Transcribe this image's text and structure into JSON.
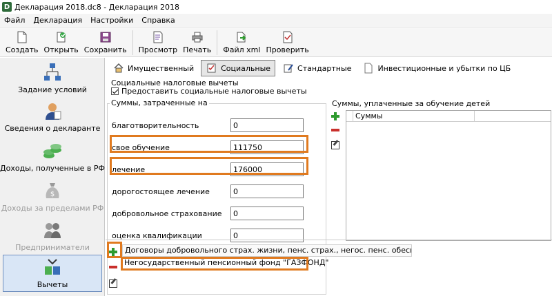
{
  "window": {
    "title": "Декларация 2018.dc8 - Декларация 2018"
  },
  "menu": [
    "Файл",
    "Декларация",
    "Настройки",
    "Справка"
  ],
  "toolbar": {
    "create": "Создать",
    "open": "Открыть",
    "save": "Сохранить",
    "preview": "Просмотр",
    "print": "Печать",
    "file_xml": "Файл xml",
    "check": "Проверить"
  },
  "sidebar": {
    "items": [
      {
        "label": "Задание условий"
      },
      {
        "label": "Сведения о декларанте"
      },
      {
        "label": "Доходы, полученные в РФ"
      },
      {
        "label": "Доходы за пределами РФ"
      },
      {
        "label": "Предприниматели"
      },
      {
        "label": "Вычеты"
      }
    ]
  },
  "tabs": [
    "Имущественный",
    "Социальные",
    "Стандартные",
    "Инвестиционные и убытки по ЦБ"
  ],
  "social": {
    "group_title": "Социальные налоговые вычеты",
    "provide_checkbox_label": "Предоставить социальные налоговые вычеты",
    "sums_title": "Суммы, затраченные на",
    "rows": [
      {
        "label": "благотворительность",
        "value": "0"
      },
      {
        "label": "свое обучение",
        "value": "111750"
      },
      {
        "label": "лечение",
        "value": "176000"
      },
      {
        "label": "дорогостоящее лечение",
        "value": "0"
      },
      {
        "label": "добровольное страхование",
        "value": "0"
      },
      {
        "label": "оценка квалификации",
        "value": "0"
      }
    ],
    "children_title": "Суммы, уплаченные за обучение детей",
    "children_column": "Суммы"
  },
  "contracts": {
    "header": "Договоры добровольного страх. жизни, пенс. страх., негос. пенс. обеспеч. и доп...",
    "row": "Негосударственный пенсионный фонд \"ГАЗФОНД\""
  },
  "colors": {
    "highlight": "#e07a1f",
    "selected_bg": "#d9e6f6"
  }
}
